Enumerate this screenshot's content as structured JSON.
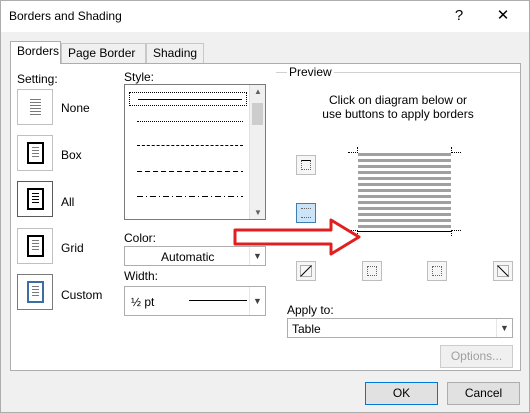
{
  "dialog": {
    "title": "Borders and Shading",
    "help_glyph": "?",
    "close_glyph": "✕"
  },
  "tabs": [
    {
      "label": "Borders",
      "active": true
    },
    {
      "label": "Page Border",
      "active": false
    },
    {
      "label": "Shading",
      "active": false
    }
  ],
  "setting": {
    "label": "Setting:",
    "options": [
      {
        "label": "None",
        "icon": "setting-none-icon"
      },
      {
        "label": "Box",
        "icon": "setting-box-icon"
      },
      {
        "label": "All",
        "icon": "setting-all-icon",
        "selected": true
      },
      {
        "label": "Grid",
        "icon": "setting-grid-icon"
      },
      {
        "label": "Custom",
        "icon": "setting-custom-icon"
      }
    ]
  },
  "style": {
    "label": "Style:",
    "items": [
      "solid",
      "dotted",
      "dashed-small",
      "dashed-large",
      "dash-dot"
    ],
    "selected": "solid"
  },
  "color": {
    "label": "Color:",
    "value": "Automatic"
  },
  "width": {
    "label": "Width:",
    "value": "½ pt"
  },
  "preview": {
    "label": "Preview",
    "instructions_line1": "Click on diagram below or",
    "instructions_line2": "use buttons to apply borders"
  },
  "apply_to": {
    "label": "Apply to:",
    "value": "Table"
  },
  "buttons": {
    "options": "Options...",
    "ok": "OK",
    "cancel": "Cancel"
  },
  "colors": {
    "annotation_arrow": "#e02020",
    "selected_border_button": "#cce4f7"
  }
}
